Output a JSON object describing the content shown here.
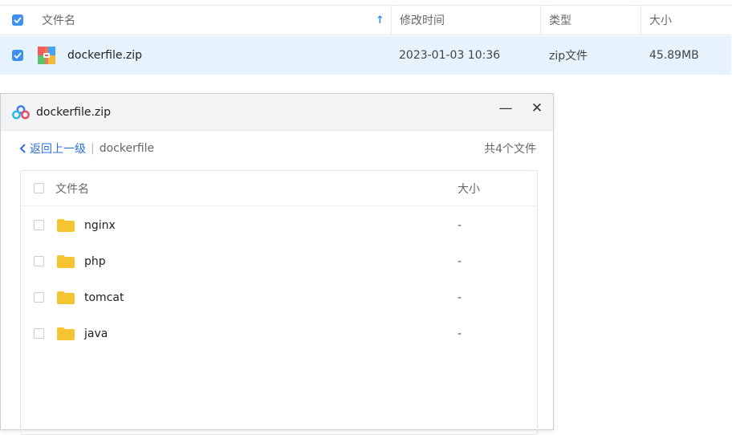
{
  "file_list": {
    "header": {
      "name": "文件名",
      "sort_arrow": "↑",
      "modified": "修改时间",
      "type": "类型",
      "size": "大小"
    },
    "rows": [
      {
        "name": "dockerfile.zip",
        "modified": "2023-01-03 10:36",
        "type": "zip文件",
        "size": "45.89MB",
        "selected": true
      }
    ]
  },
  "dialog": {
    "title": "dockerfile.zip",
    "minimize": "—",
    "close": "✕",
    "back": "返回上一级",
    "separator": "|",
    "current_folder": "dockerfile",
    "count": "共4个文件",
    "table": {
      "header_name": "文件名",
      "header_size": "大小",
      "items": [
        {
          "name": "nginx",
          "size": "-"
        },
        {
          "name": "php",
          "size": "-"
        },
        {
          "name": "tomcat",
          "size": "-"
        },
        {
          "name": "java",
          "size": "-"
        }
      ]
    }
  },
  "colors": {
    "accent": "#3e90ee",
    "selected_row": "#e6f3fd",
    "folder": "#f5c531",
    "link": "#2d6fd8"
  }
}
